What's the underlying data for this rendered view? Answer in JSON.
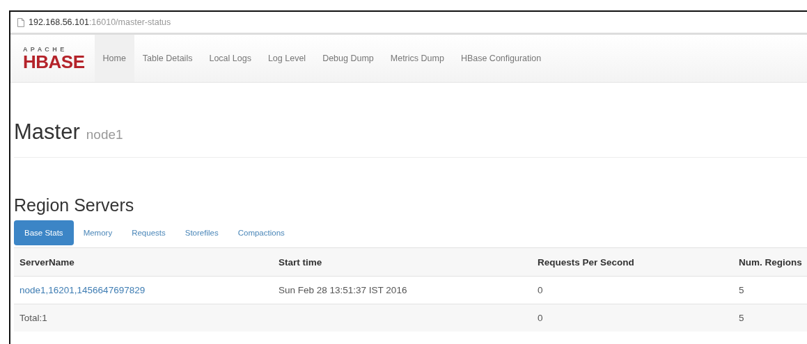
{
  "address_bar": {
    "host": "192.168.56.101",
    "path": ":16010/master-status"
  },
  "logo": {
    "top": "A P A C H E",
    "bottom": "HBASE"
  },
  "nav": [
    {
      "label": "Home",
      "selected": true
    },
    {
      "label": "Table Details",
      "selected": false
    },
    {
      "label": "Local Logs",
      "selected": false
    },
    {
      "label": "Log Level",
      "selected": false
    },
    {
      "label": "Debug Dump",
      "selected": false
    },
    {
      "label": "Metrics Dump",
      "selected": false
    },
    {
      "label": "HBase Configuration",
      "selected": false
    }
  ],
  "heading": {
    "title": "Master",
    "subtitle": "node1"
  },
  "section_title": "Region Servers",
  "tabs": [
    {
      "label": "Base Stats",
      "selected": true
    },
    {
      "label": "Memory",
      "selected": false
    },
    {
      "label": "Requests",
      "selected": false
    },
    {
      "label": "Storefiles",
      "selected": false
    },
    {
      "label": "Compactions",
      "selected": false
    }
  ],
  "table": {
    "columns": [
      "ServerName",
      "Start time",
      "Requests Per Second",
      "Num. Regions"
    ],
    "rows": [
      {
        "cells": [
          "node1,16201,1456647697829",
          "Sun Feb 28 13:51:37 IST 2016",
          "0",
          "5"
        ],
        "link": true
      },
      {
        "cells": [
          "Total:1",
          "",
          "0",
          "5"
        ],
        "link": false
      }
    ]
  }
}
